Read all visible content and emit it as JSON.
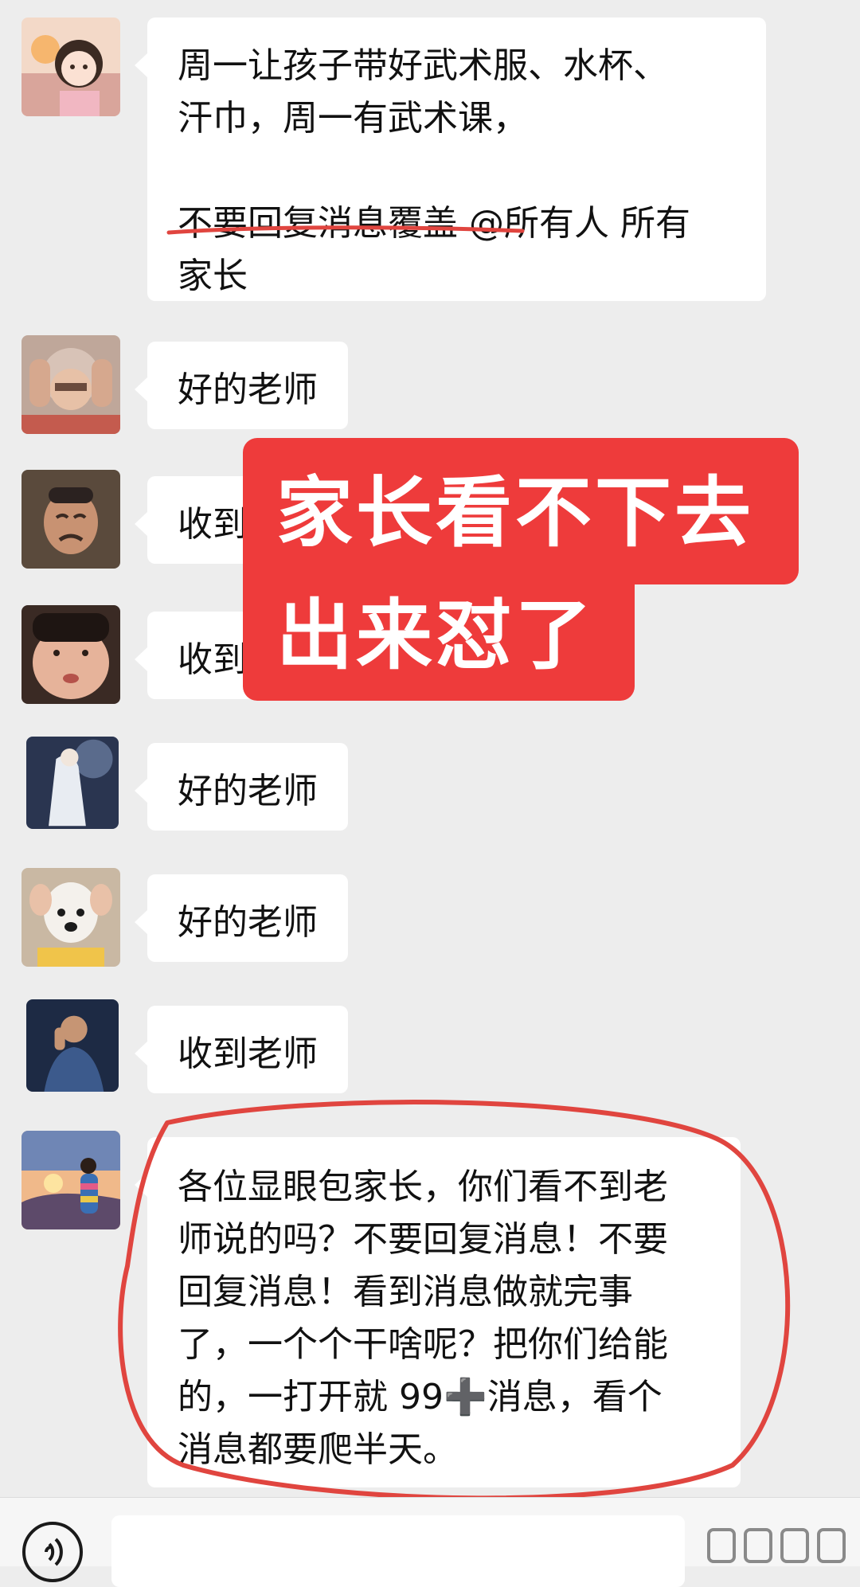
{
  "messages": [
    {
      "avatar_icon": "cartoon-girl-avatar-icon",
      "lines": [
        "周一让孩子带好武术服、水杯、",
        "汗巾，周一有武术课，"
      ],
      "lines2": [
        "不要回复消息覆盖 @所有人 所有",
        "家长"
      ]
    },
    {
      "avatar_icon": "elderly-woman-holding-head-avatar-icon",
      "text": "好的老师"
    },
    {
      "avatar_icon": "crying-old-man-avatar-icon",
      "text": "收到"
    },
    {
      "avatar_icon": "puffed-face-avatar-icon",
      "text": "收到"
    },
    {
      "avatar_icon": "white-robed-figure-avatar-icon",
      "text": "好的老师"
    },
    {
      "avatar_icon": "dog-avatar-icon",
      "text": "好的老师"
    },
    {
      "avatar_icon": "man-on-phone-avatar-icon",
      "text": "收到老师"
    },
    {
      "avatar_icon": "sunset-woman-avatar-icon",
      "lines": [
        "各位显眼包家长，你们看不到老",
        "师说的吗？不要回复消息！不要",
        "回复消息！看到消息做就完事",
        "了，一个个干啥呢？把你们给能",
        "的，一打开就 99➕消息，看个",
        "消息都要爬半天。"
      ]
    }
  ],
  "overlay": {
    "line1": "家长看不下去",
    "line2": "出来怼了",
    "color": "#ee3b3b"
  },
  "annotations": {
    "color": "#e0453f"
  },
  "input_bar": {
    "voice_icon": "voice-icon"
  }
}
